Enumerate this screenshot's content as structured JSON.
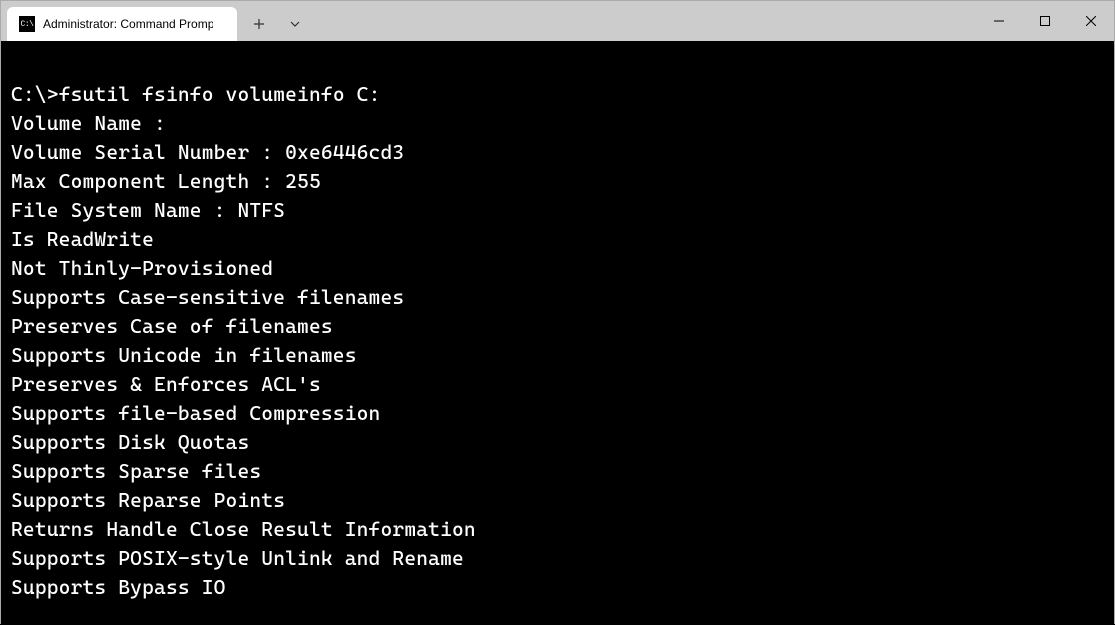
{
  "window": {
    "tab_title": "Administrator: Command Prompt",
    "tab_icon_text": "C:\\"
  },
  "terminal": {
    "prompt": "C:\\>",
    "command": "fsutil fsinfo volumeinfo C:",
    "lines": [
      "Volume Name :",
      "Volume Serial Number : 0xe6446cd3",
      "Max Component Length : 255",
      "File System Name : NTFS",
      "Is ReadWrite",
      "Not Thinly-Provisioned",
      "Supports Case-sensitive filenames",
      "Preserves Case of filenames",
      "Supports Unicode in filenames",
      "Preserves & Enforces ACL's",
      "Supports file-based Compression",
      "Supports Disk Quotas",
      "Supports Sparse files",
      "Supports Reparse Points",
      "Returns Handle Close Result Information",
      "Supports POSIX-style Unlink and Rename",
      "Supports Bypass IO"
    ]
  }
}
